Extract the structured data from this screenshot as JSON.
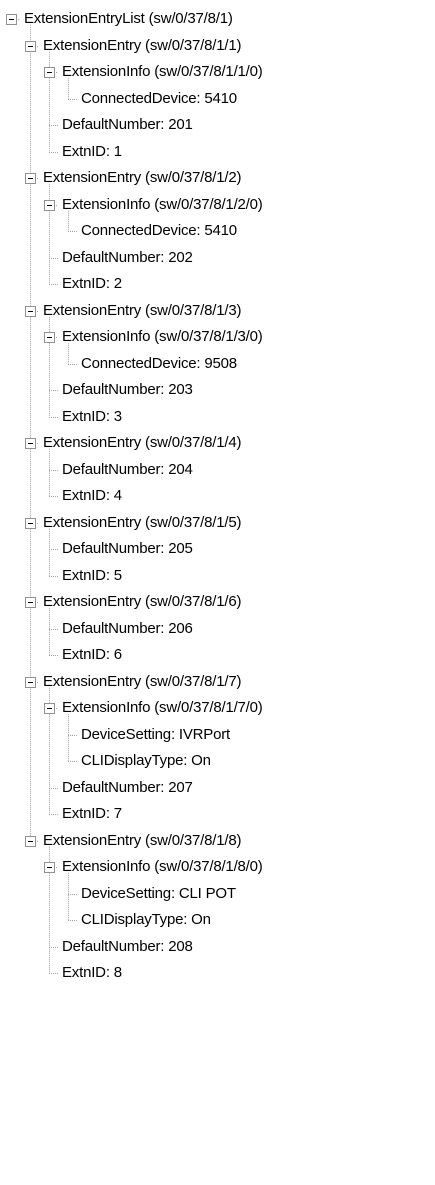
{
  "tree": {
    "nodes": [
      {
        "label": "ExtensionEntryList (sw/0/37/8/1)",
        "depth": 0,
        "expanded": true
      },
      {
        "label": "ExtensionEntry (sw/0/37/8/1/1)",
        "depth": 1,
        "expanded": true
      },
      {
        "label": "ExtensionInfo (sw/0/37/8/1/1/0)",
        "depth": 2,
        "expanded": true
      },
      {
        "label": "ConnectedDevice: 5410",
        "depth": 3
      },
      {
        "label": "DefaultNumber: 201",
        "depth": 2
      },
      {
        "label": "ExtnID: 1",
        "depth": 2
      },
      {
        "label": "ExtensionEntry (sw/0/37/8/1/2)",
        "depth": 1,
        "expanded": true
      },
      {
        "label": "ExtensionInfo (sw/0/37/8/1/2/0)",
        "depth": 2,
        "expanded": true
      },
      {
        "label": "ConnectedDevice: 5410",
        "depth": 3
      },
      {
        "label": "DefaultNumber: 202",
        "depth": 2
      },
      {
        "label": "ExtnID: 2",
        "depth": 2
      },
      {
        "label": "ExtensionEntry (sw/0/37/8/1/3)",
        "depth": 1,
        "expanded": true
      },
      {
        "label": "ExtensionInfo (sw/0/37/8/1/3/0)",
        "depth": 2,
        "expanded": true
      },
      {
        "label": "ConnectedDevice: 9508",
        "depth": 3
      },
      {
        "label": "DefaultNumber: 203",
        "depth": 2
      },
      {
        "label": "ExtnID: 3",
        "depth": 2
      },
      {
        "label": "ExtensionEntry (sw/0/37/8/1/4)",
        "depth": 1,
        "expanded": true
      },
      {
        "label": "DefaultNumber: 204",
        "depth": 2
      },
      {
        "label": "ExtnID: 4",
        "depth": 2
      },
      {
        "label": "ExtensionEntry (sw/0/37/8/1/5)",
        "depth": 1,
        "expanded": true
      },
      {
        "label": "DefaultNumber: 205",
        "depth": 2
      },
      {
        "label": "ExtnID: 5",
        "depth": 2
      },
      {
        "label": "ExtensionEntry (sw/0/37/8/1/6)",
        "depth": 1,
        "expanded": true
      },
      {
        "label": "DefaultNumber: 206",
        "depth": 2
      },
      {
        "label": "ExtnID: 6",
        "depth": 2
      },
      {
        "label": "ExtensionEntry (sw/0/37/8/1/7)",
        "depth": 1,
        "expanded": true
      },
      {
        "label": "ExtensionInfo (sw/0/37/8/1/7/0)",
        "depth": 2,
        "expanded": true
      },
      {
        "label": "DeviceSetting: IVRPort",
        "depth": 3
      },
      {
        "label": "CLIDisplayType: On",
        "depth": 3
      },
      {
        "label": "DefaultNumber: 207",
        "depth": 2
      },
      {
        "label": "ExtnID: 7",
        "depth": 2
      },
      {
        "label": "ExtensionEntry (sw/0/37/8/1/8)",
        "depth": 1,
        "expanded": true
      },
      {
        "label": "ExtensionInfo (sw/0/37/8/1/8/0)",
        "depth": 2,
        "expanded": true
      },
      {
        "label": "DeviceSetting: CLI POT",
        "depth": 3
      },
      {
        "label": "CLIDisplayType: On",
        "depth": 3
      },
      {
        "label": "DefaultNumber: 208",
        "depth": 2
      },
      {
        "label": "ExtnID: 8",
        "depth": 2
      }
    ]
  }
}
